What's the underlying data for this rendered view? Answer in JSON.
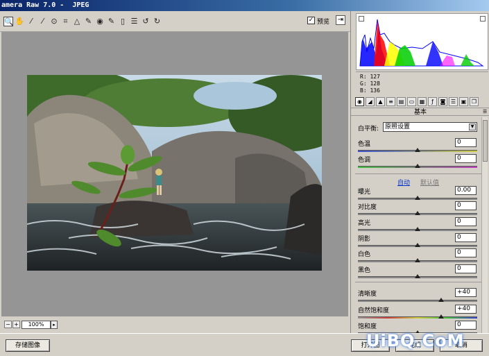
{
  "window": {
    "title": "amera Raw 7.0 -  JPEG"
  },
  "toolbar": {
    "tools": [
      {
        "icon": "zoom-icon",
        "glyph": "🔍"
      },
      {
        "icon": "hand-icon",
        "glyph": "✋"
      },
      {
        "icon": "white-balance-icon",
        "glyph": "⁄"
      },
      {
        "icon": "color-sampler-icon",
        "glyph": "⁄"
      },
      {
        "icon": "target-adjust-icon",
        "glyph": "⊙"
      },
      {
        "icon": "crop-icon",
        "glyph": "⌗"
      },
      {
        "icon": "straighten-icon",
        "glyph": "△"
      },
      {
        "icon": "spot-removal-icon",
        "glyph": "✎"
      },
      {
        "icon": "red-eye-icon",
        "glyph": "◉"
      },
      {
        "icon": "adjustment-brush-icon",
        "glyph": "✎"
      },
      {
        "icon": "graduated-filter-icon",
        "glyph": "▯"
      },
      {
        "icon": "preferences-icon",
        "glyph": "☰"
      },
      {
        "icon": "rotate-left-icon",
        "glyph": "↺"
      },
      {
        "icon": "rotate-right-icon",
        "glyph": "↻"
      }
    ],
    "preview_checked": "✓",
    "preview_label": "预览"
  },
  "status": {
    "zoom": "100%",
    "zoom_out": "−",
    "zoom_in": "+"
  },
  "readout": {
    "r": "R:  127",
    "g": "G:  128",
    "b": "B:  136"
  },
  "panel": {
    "title": "基本",
    "white_balance_label": "白平衡:",
    "white_balance_value": "原照设置",
    "auto_label": "自动",
    "default_label": "默认值",
    "sliders": [
      {
        "label": "色温",
        "value": "0",
        "pos": 0.5
      },
      {
        "label": "色调",
        "value": "0",
        "pos": 0.5
      },
      {
        "label": "曝光",
        "value": "0.00",
        "pos": 0.5
      },
      {
        "label": "对比度",
        "value": "0",
        "pos": 0.5
      },
      {
        "label": "高光",
        "value": "0",
        "pos": 0.5
      },
      {
        "label": "阴影",
        "value": "0",
        "pos": 0.5
      },
      {
        "label": "白色",
        "value": "0",
        "pos": 0.5
      },
      {
        "label": "黑色",
        "value": "0",
        "pos": 0.5
      },
      {
        "label": "清晰度",
        "value": "+40",
        "pos": 0.7
      },
      {
        "label": "自然饱和度",
        "value": "+40",
        "pos": 0.7
      },
      {
        "label": "饱和度",
        "value": "0",
        "pos": 0.5
      }
    ]
  },
  "buttons": {
    "save": "存储图像",
    "open": "打开图",
    "done": "完成",
    "cancel": "取消"
  },
  "watermark": "UiBQ.CoM"
}
